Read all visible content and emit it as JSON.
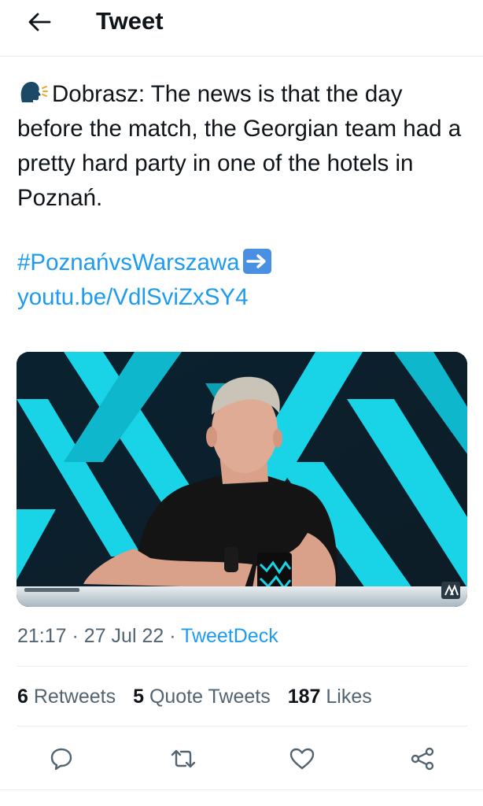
{
  "header": {
    "title": "Tweet",
    "back_icon": "arrow-left-icon"
  },
  "tweet": {
    "emoji": "speaking-head-icon",
    "text": "Dobrasz: The news is that the day before the match, the Georgian team had a pretty hard party in one of the hotels in Poznań.",
    "hashtag": "#PoznańvsWarszawa",
    "arrow_emoji": "right-arrow-icon",
    "link": "youtu.be/VdlSviZxSY4"
  },
  "meta": {
    "time": "21:17",
    "date": "27 Jul 22",
    "source": "TweetDeck",
    "separator": "·"
  },
  "stats": {
    "retweets_count": "6",
    "retweets_label": "Retweets",
    "quotes_count": "5",
    "quotes_label": "Quote Tweets",
    "likes_count": "187",
    "likes_label": "Likes"
  },
  "actions": [
    "reply-icon",
    "retweet-icon",
    "like-icon",
    "share-icon"
  ],
  "colors": {
    "link": "#1d9bf0",
    "text": "#0f1419",
    "secondary": "#536471",
    "divider": "#e6ecf0",
    "studio_cyan": "#19d3e6"
  }
}
